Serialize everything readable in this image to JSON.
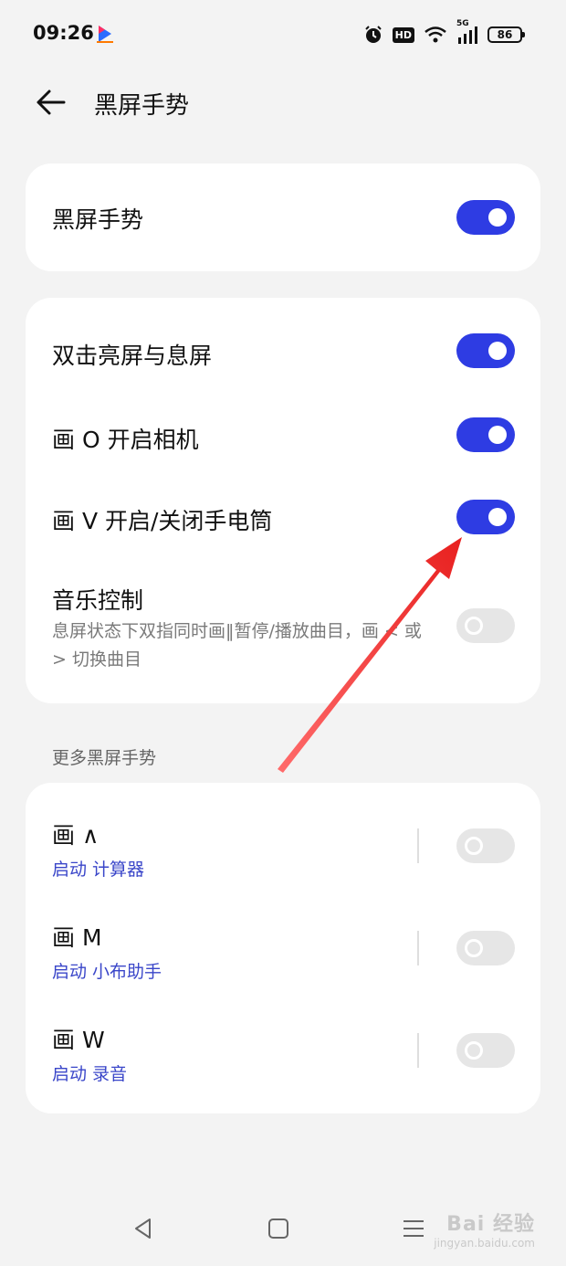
{
  "status_bar": {
    "time": "09:26",
    "hd_label": "HD",
    "network_label": "5G",
    "battery_level": "86",
    "icons": [
      "alarm-icon",
      "hd-icon",
      "wifi-icon",
      "signal-icon",
      "battery-icon"
    ]
  },
  "header": {
    "title": "黑屏手势"
  },
  "master": {
    "label": "黑屏手势",
    "enabled": true
  },
  "gestures": [
    {
      "title": "双击亮屏与息屏",
      "enabled": true
    },
    {
      "title": "画 O 开启相机",
      "enabled": true
    },
    {
      "title": "画 V 开启/关闭手电筒",
      "enabled": true
    },
    {
      "title": "音乐控制",
      "subtitle": "息屏状态下双指同时画‖暂停/播放曲目，画 < 或 > 切换曲目",
      "enabled": false
    }
  ],
  "more": {
    "section_label": "更多黑屏手势",
    "items": [
      {
        "title": "画 ∧",
        "action": "启动 计算器",
        "enabled": false
      },
      {
        "title": "画 M",
        "action": "启动 小布助手",
        "enabled": false
      },
      {
        "title": "画 W",
        "action": "启动 录音",
        "enabled": false
      }
    ]
  },
  "nav": {
    "buttons": [
      "back-triangle-icon",
      "home-square-icon",
      "recents-menu-icon"
    ]
  },
  "watermark": {
    "main": "Bai 经验",
    "sub": "jingyan.baidu.com"
  },
  "colors": {
    "accent": "#2e3ce3",
    "action_text": "#3a46c9",
    "annotation_arrow": "#e8201f",
    "background": "#f3f3f3"
  }
}
